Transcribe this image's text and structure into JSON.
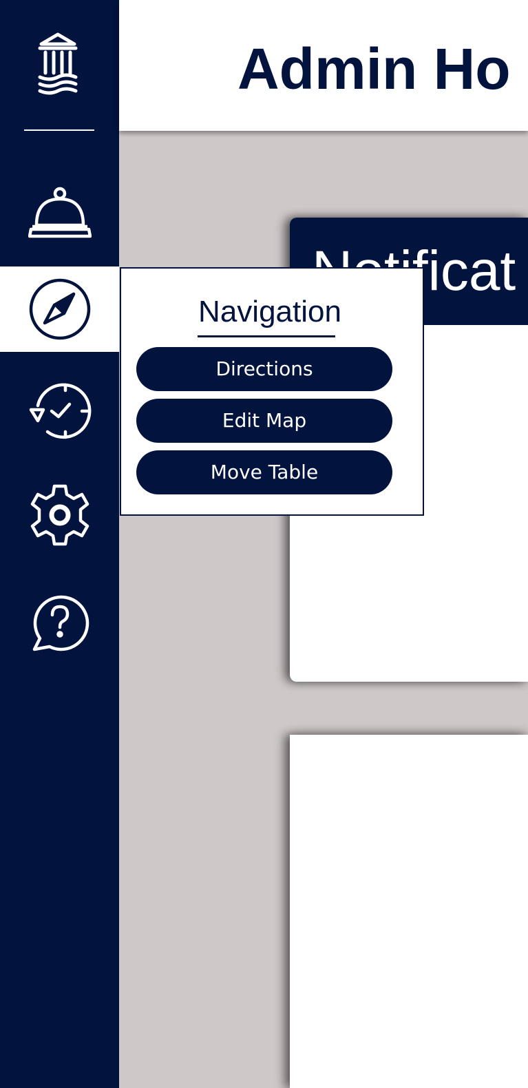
{
  "header": {
    "title": "Admin Ho"
  },
  "notifications_card": {
    "title": "Notificat"
  },
  "sidebar": {
    "items": [
      {
        "icon": "service-bell-icon",
        "active": false
      },
      {
        "icon": "compass-icon",
        "active": true
      },
      {
        "icon": "history-icon",
        "active": false
      },
      {
        "icon": "gear-icon",
        "active": false
      },
      {
        "icon": "help-chat-icon",
        "active": false
      }
    ]
  },
  "navigation_menu": {
    "title": "Navigation",
    "buttons": [
      {
        "label": "Directions"
      },
      {
        "label": "Edit Map"
      },
      {
        "label": "Move Table"
      }
    ]
  },
  "colors": {
    "navy": "#02133d",
    "background": "#cfc8c9",
    "white": "#ffffff"
  }
}
